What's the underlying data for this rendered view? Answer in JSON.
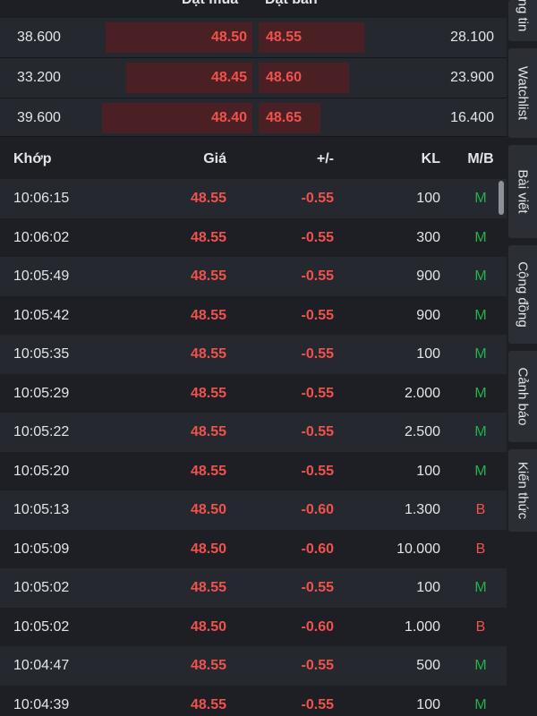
{
  "orderbook": {
    "bid_header": "Đặt mua",
    "ask_header": "Đặt bán",
    "rows": [
      {
        "bid_vol": "38.600",
        "bid_price": "48.50",
        "ask_price": "48.55",
        "ask_vol": "28.100"
      },
      {
        "bid_vol": "33.200",
        "bid_price": "48.45",
        "ask_price": "48.60",
        "ask_vol": "23.900"
      },
      {
        "bid_vol": "39.600",
        "bid_price": "48.40",
        "ask_price": "48.65",
        "ask_vol": "16.400"
      }
    ]
  },
  "trades": {
    "headers": {
      "time": "Khớp",
      "price": "Giá",
      "change": "+/-",
      "volume": "KL",
      "side": "M/B"
    },
    "rows": [
      {
        "time": "10:06:15",
        "price": "48.55",
        "change": "-0.55",
        "volume": "100",
        "side": "M"
      },
      {
        "time": "10:06:02",
        "price": "48.55",
        "change": "-0.55",
        "volume": "300",
        "side": "M"
      },
      {
        "time": "10:05:49",
        "price": "48.55",
        "change": "-0.55",
        "volume": "900",
        "side": "M"
      },
      {
        "time": "10:05:42",
        "price": "48.55",
        "change": "-0.55",
        "volume": "900",
        "side": "M"
      },
      {
        "time": "10:05:35",
        "price": "48.55",
        "change": "-0.55",
        "volume": "100",
        "side": "M"
      },
      {
        "time": "10:05:29",
        "price": "48.55",
        "change": "-0.55",
        "volume": "2.000",
        "side": "M"
      },
      {
        "time": "10:05:22",
        "price": "48.55",
        "change": "-0.55",
        "volume": "2.500",
        "side": "M"
      },
      {
        "time": "10:05:20",
        "price": "48.55",
        "change": "-0.55",
        "volume": "100",
        "side": "M"
      },
      {
        "time": "10:05:13",
        "price": "48.50",
        "change": "-0.60",
        "volume": "1.300",
        "side": "B"
      },
      {
        "time": "10:05:09",
        "price": "48.50",
        "change": "-0.60",
        "volume": "10.000",
        "side": "B"
      },
      {
        "time": "10:05:02",
        "price": "48.55",
        "change": "-0.55",
        "volume": "100",
        "side": "M"
      },
      {
        "time": "10:05:02",
        "price": "48.50",
        "change": "-0.60",
        "volume": "1.000",
        "side": "B"
      },
      {
        "time": "10:04:47",
        "price": "48.55",
        "change": "-0.55",
        "volume": "500",
        "side": "M"
      },
      {
        "time": "10:04:39",
        "price": "48.55",
        "change": "-0.55",
        "volume": "100",
        "side": "M"
      }
    ]
  },
  "side_tabs": [
    {
      "label": "ng tin"
    },
    {
      "label": "Watchlist"
    },
    {
      "label": "Bài viết"
    },
    {
      "label": "Cộng đồng"
    },
    {
      "label": "Cảnh báo"
    },
    {
      "label": "Kiến thức"
    }
  ],
  "colors": {
    "down": "#f0524c",
    "buy": "#1fb34a",
    "bar": "#4a2025"
  }
}
